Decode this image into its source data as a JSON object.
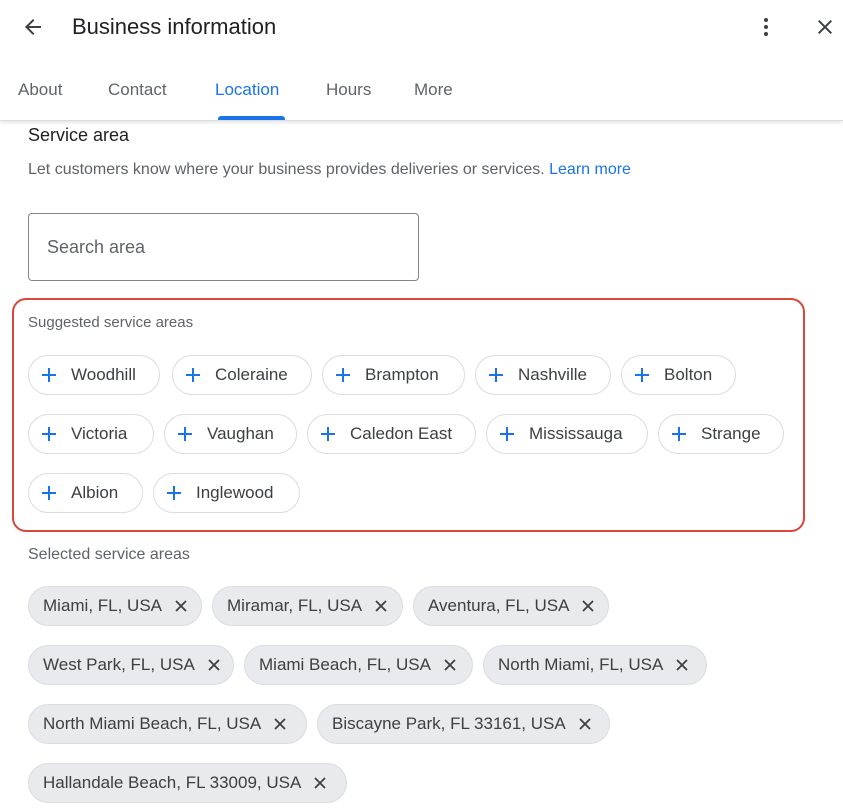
{
  "header": {
    "title": "Business information",
    "icons": {
      "back": "arrow-back-icon",
      "more": "more-vert-icon",
      "close": "close-icon"
    }
  },
  "tabs": [
    {
      "label": "About"
    },
    {
      "label": "Contact"
    },
    {
      "label": "Location",
      "active": true
    },
    {
      "label": "Hours"
    },
    {
      "label": "More"
    }
  ],
  "service_area": {
    "title": "Service area",
    "description": "Let customers know where your business provides deliveries or services.",
    "learn_more": "Learn more",
    "search": {
      "placeholder": "Search area",
      "value": ""
    },
    "suggested_label": "Suggested service areas",
    "suggested": [
      "Woodhill",
      "Coleraine",
      "Brampton",
      "Nashville",
      "Bolton",
      "Victoria",
      "Vaughan",
      "Caledon East",
      "Mississauga",
      "Strange",
      "Albion",
      "Inglewood"
    ],
    "selected_label": "Selected service areas",
    "selected": [
      "Miami, FL, USA",
      "Miramar, FL, USA",
      "Aventura, FL, USA",
      "West Park, FL, USA",
      "Miami Beach, FL, USA",
      "North Miami, FL, USA",
      "North Miami Beach, FL, USA",
      "Biscayne Park, FL 33161, USA",
      "Hallandale Beach, FL 33009, USA"
    ]
  },
  "colors": {
    "accent": "#1a73e8",
    "highlight_border": "#d9473b",
    "selected_chip_bg": "#e8eaed"
  }
}
